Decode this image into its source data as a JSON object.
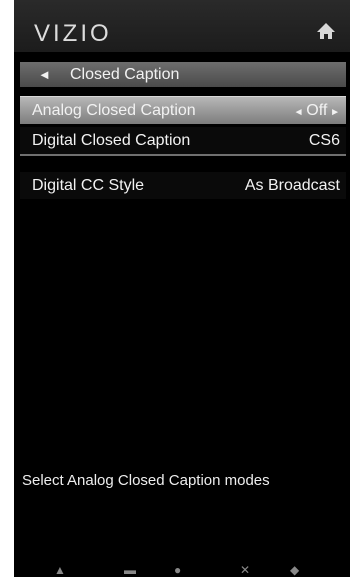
{
  "header": {
    "brand": "VIZIO"
  },
  "breadcrumb": {
    "label": "Closed Caption",
    "back_glyph": "◄"
  },
  "menu": [
    {
      "label": "Analog Closed Caption",
      "value": "Off",
      "selected": true
    },
    {
      "label": "Digital Closed Caption",
      "value": "CS6",
      "selected": false
    },
    {
      "label": "Digital CC Style",
      "value": "As Broadcast",
      "selected": false
    }
  ],
  "help_text": "Select Analog Closed Caption modes",
  "icons": {
    "home": "home-icon",
    "left": "chevron-left-icon",
    "right": "chevron-right-icon"
  }
}
